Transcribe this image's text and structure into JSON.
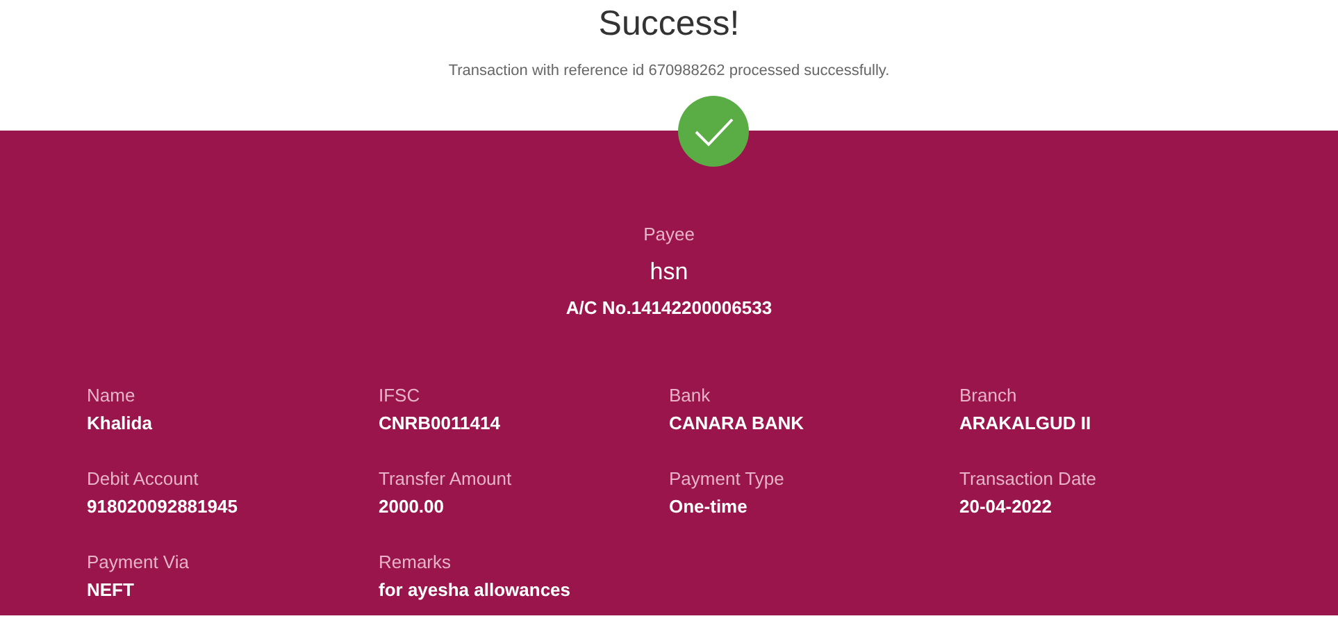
{
  "title": "Success!",
  "message": "Transaction with reference id 670988262 processed successfully.",
  "payee": {
    "label": "Payee",
    "name": "hsn",
    "account": "A/C No.14142200006533"
  },
  "details": [
    {
      "label": "Name",
      "value": "Khalida"
    },
    {
      "label": "IFSC",
      "value": "CNRB0011414"
    },
    {
      "label": "Bank",
      "value": "CANARA BANK"
    },
    {
      "label": "Branch",
      "value": "ARAKALGUD II"
    },
    {
      "label": "Debit Account",
      "value": "918020092881945"
    },
    {
      "label": "Transfer Amount",
      "value": "2000.00"
    },
    {
      "label": "Payment Type",
      "value": "One-time"
    },
    {
      "label": "Transaction Date",
      "value": "20-04-2022"
    },
    {
      "label": "Payment Via",
      "value": "NEFT"
    },
    {
      "label": "Remarks",
      "value": "for ayesha allowances"
    }
  ]
}
